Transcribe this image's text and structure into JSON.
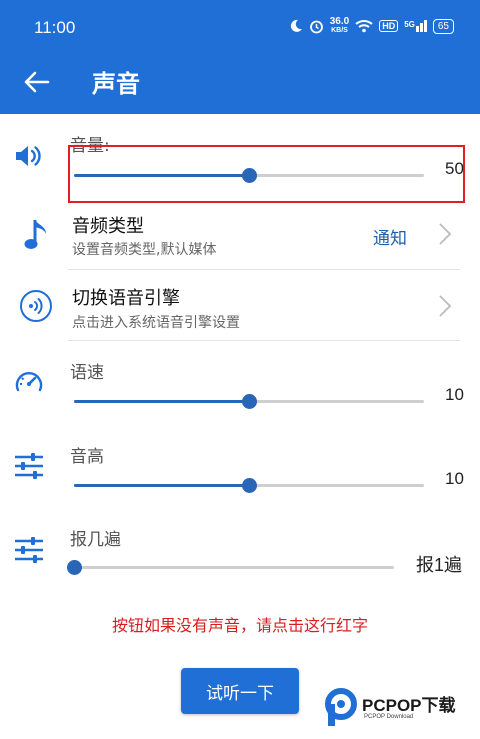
{
  "status_bar": {
    "time": "11:00",
    "net_speed": "36.0",
    "net_unit": "KB/S",
    "hd": "HD",
    "signal": "5G",
    "battery": "65"
  },
  "app_bar": {
    "title": "声音",
    "back_icon": "arrow-left-icon"
  },
  "volume": {
    "label": "音量:",
    "value": "50",
    "level": 0.5,
    "icon": "speaker-icon"
  },
  "audio_type": {
    "title": "音频类型",
    "subtitle": "设置音频类型,默认媒体",
    "value": "通知",
    "icon": "music-note-icon"
  },
  "tts_engine": {
    "title": "切换语音引擎",
    "subtitle": "点击进入系统语音引擎设置",
    "icon": "broadcast-icon"
  },
  "speed": {
    "label": "语速",
    "value": "10",
    "level": 0.5,
    "icon": "speedometer-icon"
  },
  "pitch": {
    "label": "音高",
    "value": "10",
    "level": 0.5,
    "icon": "sliders-icon"
  },
  "repeat": {
    "label": "报几遍",
    "value": "报1遍",
    "level": 0.0,
    "icon": "sliders-icon"
  },
  "hint": "按钮如果没有声音，请点击这行红字",
  "test_button": "试听一下",
  "watermark": {
    "text": "PCPOP下载",
    "sub": "PCPOP Download"
  },
  "colors": {
    "primary": "#1f6fd6",
    "slider": "#2a66b8",
    "hint": "#d81e1e",
    "highlight": "#e02020"
  }
}
